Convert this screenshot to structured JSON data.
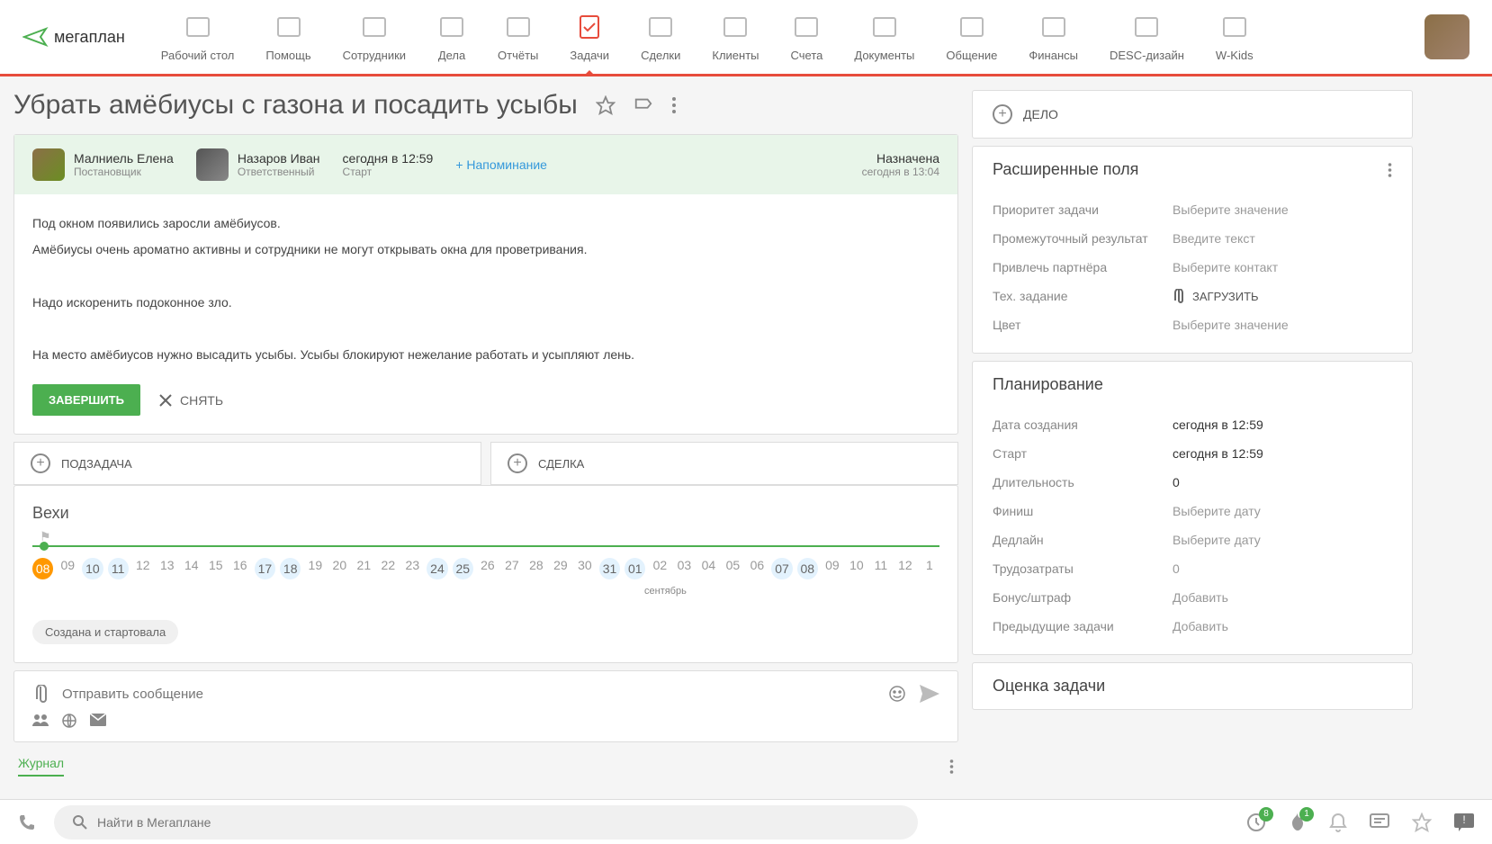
{
  "logo": "мегаплан",
  "nav": [
    {
      "label": "Рабочий стол"
    },
    {
      "label": "Помощь"
    },
    {
      "label": "Сотрудники"
    },
    {
      "label": "Дела"
    },
    {
      "label": "Отчёты"
    },
    {
      "label": "Задачи"
    },
    {
      "label": "Сделки"
    },
    {
      "label": "Клиенты"
    },
    {
      "label": "Счета"
    },
    {
      "label": "Документы"
    },
    {
      "label": "Общение"
    },
    {
      "label": "Финансы"
    },
    {
      "label": "DESC-дизайн"
    },
    {
      "label": "W-Kids"
    }
  ],
  "task": {
    "title": "Убрать амёбиусы с газона и посадить усыбы",
    "owner": {
      "name": "Малниель Елена",
      "role": "Постановщик"
    },
    "assignee": {
      "name": "Назаров Иван",
      "role": "Ответственный"
    },
    "time": {
      "at": "сегодня в 12:59",
      "label": "Старт"
    },
    "reminder": "+ Напоминание",
    "status": {
      "name": "Назначена",
      "time": "сегодня в 13:04"
    },
    "desc": {
      "p1": "Под окном появились заросли амёбиусов.",
      "p2": "Амёбиусы очень ароматно активны и сотрудники не могут открывать окна для проветривания.",
      "p3": "Надо искоренить подоконное зло.",
      "p4": "На место амёбиусов нужно высадить усыбы. Усыбы блокируют нежелание работать и усыпляют лень."
    },
    "btn_complete": "ЗАВЕРШИТЬ",
    "btn_remove": "СНЯТЬ",
    "subtask": "ПОДЗАДАЧА",
    "deal": "СДЕЛКА"
  },
  "milestones": {
    "title": "Вехи",
    "days": [
      "08",
      "09",
      "10",
      "11",
      "12",
      "13",
      "14",
      "15",
      "16",
      "17",
      "18",
      "19",
      "20",
      "21",
      "22",
      "23",
      "24",
      "25",
      "26",
      "27",
      "28",
      "29",
      "30",
      "31",
      "01",
      "02",
      "03",
      "04",
      "05",
      "06",
      "07",
      "08",
      "09",
      "10",
      "11",
      "12",
      "1"
    ],
    "today_idx": 0,
    "weekend_idx": [
      2,
      3,
      9,
      10,
      16,
      17,
      23,
      24,
      30,
      31
    ],
    "month": "сентябрь",
    "badge": "Создана и стартовала"
  },
  "message": {
    "placeholder": "Отправить сообщение"
  },
  "journal": "Журнал",
  "side": {
    "action": "ДЕЛО",
    "ext_title": "Расширенные поля",
    "fields": [
      {
        "l": "Приоритет задачи",
        "v": "Выберите значение"
      },
      {
        "l": "Промежуточный результат",
        "v": "Введите текст"
      },
      {
        "l": "Привлечь партнёра",
        "v": "Выберите контакт"
      },
      {
        "l": "Тех. задание",
        "v": "ЗАГРУЗИТЬ",
        "upload": true
      },
      {
        "l": "Цвет",
        "v": "Выберите значение"
      }
    ],
    "plan_title": "Планирование",
    "plan": [
      {
        "l": "Дата создания",
        "v": "сегодня в 12:59",
        "f": true
      },
      {
        "l": "Старт",
        "v": "сегодня в 12:59",
        "f": true
      },
      {
        "l": "Длительность",
        "v": "0",
        "f": true
      },
      {
        "l": "Финиш",
        "v": "Выберите дату"
      },
      {
        "l": "Дедлайн",
        "v": "Выберите дату"
      },
      {
        "l": "Трудозатраты",
        "v": "0"
      },
      {
        "l": "Бонус/штраф",
        "v": "Добавить"
      },
      {
        "l": "Предыдущие задачи",
        "v": "Добавить"
      }
    ],
    "rate_title": "Оценка задачи"
  },
  "search": {
    "placeholder": "Найти в Мегаплане"
  },
  "badges": {
    "clock": "8",
    "fire": "1"
  }
}
